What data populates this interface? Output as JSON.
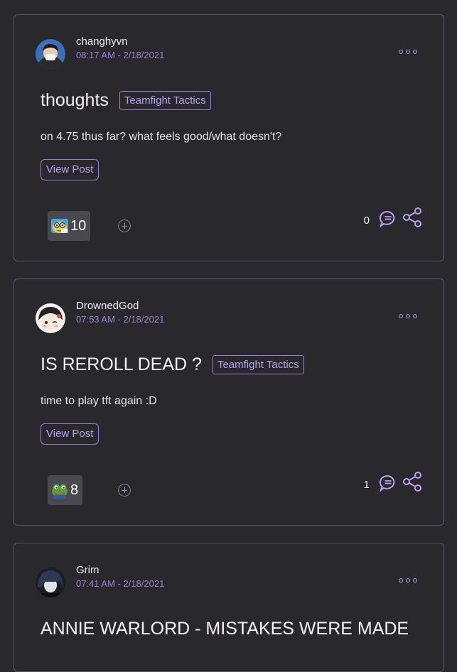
{
  "posts": [
    {
      "username": "changhyvn",
      "time": "08:17 AM - 2/18/2021",
      "title": "thoughts",
      "tag": "Teamfight Tactics",
      "body": "on 4.75 thus far? what feels good/what doesn't?",
      "view_post": "View Post",
      "reaction_count": "10",
      "reaction_emoji": "nerd-emote-icon",
      "comment_count": "0"
    },
    {
      "username": "DrownedGod",
      "time": "07:53 AM - 2/18/2021",
      "title": "IS REROLL DEAD ?",
      "tag": "Teamfight Tactics",
      "body": "time to play tft again :D",
      "view_post": "View Post",
      "reaction_count": "8",
      "reaction_emoji": "frog-emote-icon",
      "comment_count": "1"
    },
    {
      "username": "Grim",
      "time": "07:41 AM - 2/18/2021",
      "title": "ANNIE WARLORD - MISTAKES WERE MADE"
    }
  ],
  "colors": {
    "background": "#29282d",
    "card_border": "#59546c",
    "accent": "#9b7ed8",
    "text": "#f0eef5"
  }
}
